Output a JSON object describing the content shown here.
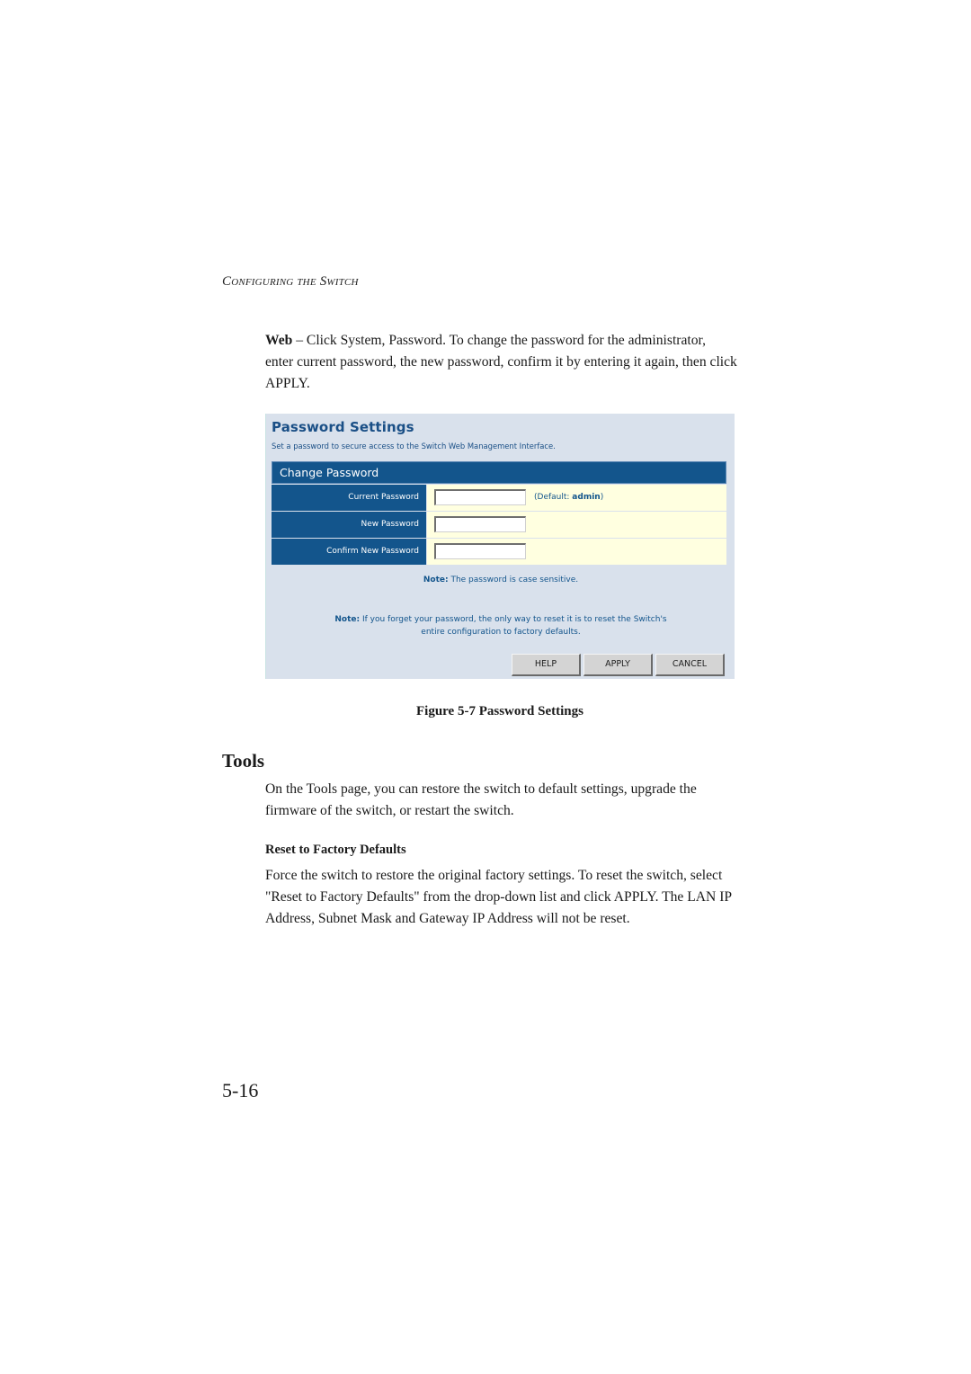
{
  "page": {
    "running_head": "Configuring the Switch",
    "intro": {
      "lead": "Web",
      "text": " – Click System, Password. To change the password for the administrator, enter current password, the new password, confirm it by entering it again, then click APPLY."
    },
    "figure_caption": "Figure 5-7  Password Settings",
    "tools_heading": "Tools",
    "tools_text": "On the Tools page, you can restore the switch to default settings, upgrade the firmware of the switch, or restart the switch.",
    "reset_heading": "Reset to Factory Defaults",
    "reset_text": "Force the switch to  restore the original factory settings.  To reset the switch, select \"Reset to Factory Defaults\" from the drop-down list and click APPLY. The LAN IP Address, Subnet Mask and Gateway IP Address will not be reset.",
    "page_number": "5-16"
  },
  "screenshot": {
    "title": "Password Settings",
    "subtitle": "Set a password to secure access to the Switch Web Management Interface.",
    "section": "Change Password",
    "fields": [
      {
        "label": "Current Password",
        "value": "",
        "hint_prefix": "(Default: ",
        "hint_value": "admin",
        "hint_suffix": ")"
      },
      {
        "label": "New Password",
        "value": ""
      },
      {
        "label": "Confirm New Password",
        "value": ""
      }
    ],
    "note1": {
      "label": "Note:",
      "text": " The password is case sensitive."
    },
    "note2": {
      "label": "Note:",
      "text": " If you forget your password, the only way to reset it is to reset the Switch's",
      "text2": "entire configuration to factory defaults."
    },
    "buttons": {
      "help": "HELP",
      "apply": "APPLY",
      "cancel": "CANCEL"
    },
    "colors": {
      "header_blue": "#13558c",
      "panel_bg": "#d9e1ec",
      "field_bg": "#ffffe0",
      "text_blue": "#1a4f86"
    }
  }
}
